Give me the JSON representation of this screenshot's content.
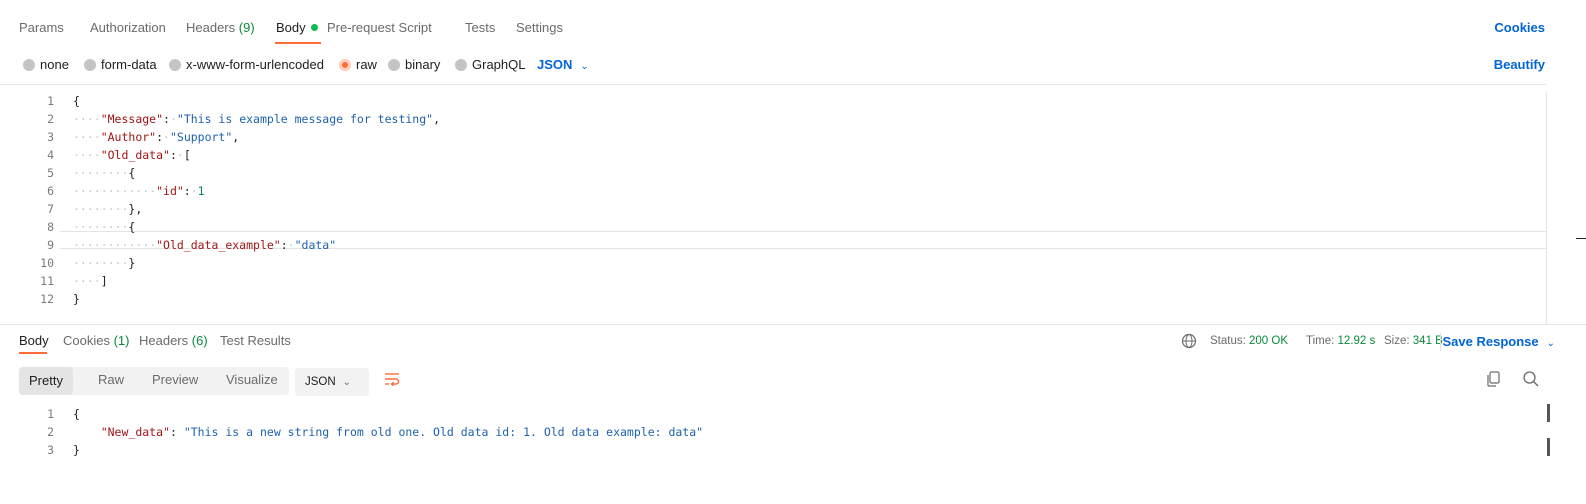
{
  "request_tabs": {
    "params": "Params",
    "authorization": "Authorization",
    "headers_label": "Headers",
    "headers_count": "(9)",
    "body": "Body",
    "prerequest": "Pre-request Script",
    "tests": "Tests",
    "settings": "Settings",
    "cookies": "Cookies"
  },
  "body_modes": {
    "none": "none",
    "form_data": "form-data",
    "urlencoded": "x-www-form-urlencoded",
    "raw": "raw",
    "binary": "binary",
    "graphql": "GraphQL",
    "selected_format": "JSON",
    "beautify": "Beautify"
  },
  "request_body_lines": [
    "1",
    "2",
    "3",
    "4",
    "5",
    "6",
    "7",
    "8",
    "9",
    "10",
    "11",
    "12"
  ],
  "request_body": {
    "message_key": "\"Message\"",
    "message_val": "\"This is example message for testing\"",
    "author_key": "\"Author\"",
    "author_val": "\"Support\"",
    "old_data_key": "\"Old_data\"",
    "id_key": "\"id\"",
    "id_val": "1",
    "old_data_example_key": "\"Old_data_example\"",
    "old_data_example_val": "\"data\""
  },
  "response_tabs": {
    "body": "Body",
    "cookies_label": "Cookies",
    "cookies_count": "(1)",
    "headers_label": "Headers",
    "headers_count": "(6)",
    "test_results": "Test Results"
  },
  "response_status": {
    "status_label": "Status:",
    "status_value": "200 OK",
    "time_label": "Time:",
    "time_value": "12.92 s",
    "size_label": "Size:",
    "size_value": "341 B",
    "save_response": "Save Response"
  },
  "response_view": {
    "pretty": "Pretty",
    "raw": "Raw",
    "preview": "Preview",
    "visualize": "Visualize",
    "format": "JSON"
  },
  "response_body_lines": [
    "1",
    "2",
    "3"
  ],
  "response_body": {
    "new_data_key": "\"New_data\"",
    "new_data_val": "\"This is a new string from old one. Old data id: 1. Old data example: data\""
  },
  "colors": {
    "accent": "#ff6c37",
    "link": "#0265d2",
    "success": "#0a8a3a",
    "json_key": "#a31515",
    "json_string": "#1f62ac"
  }
}
